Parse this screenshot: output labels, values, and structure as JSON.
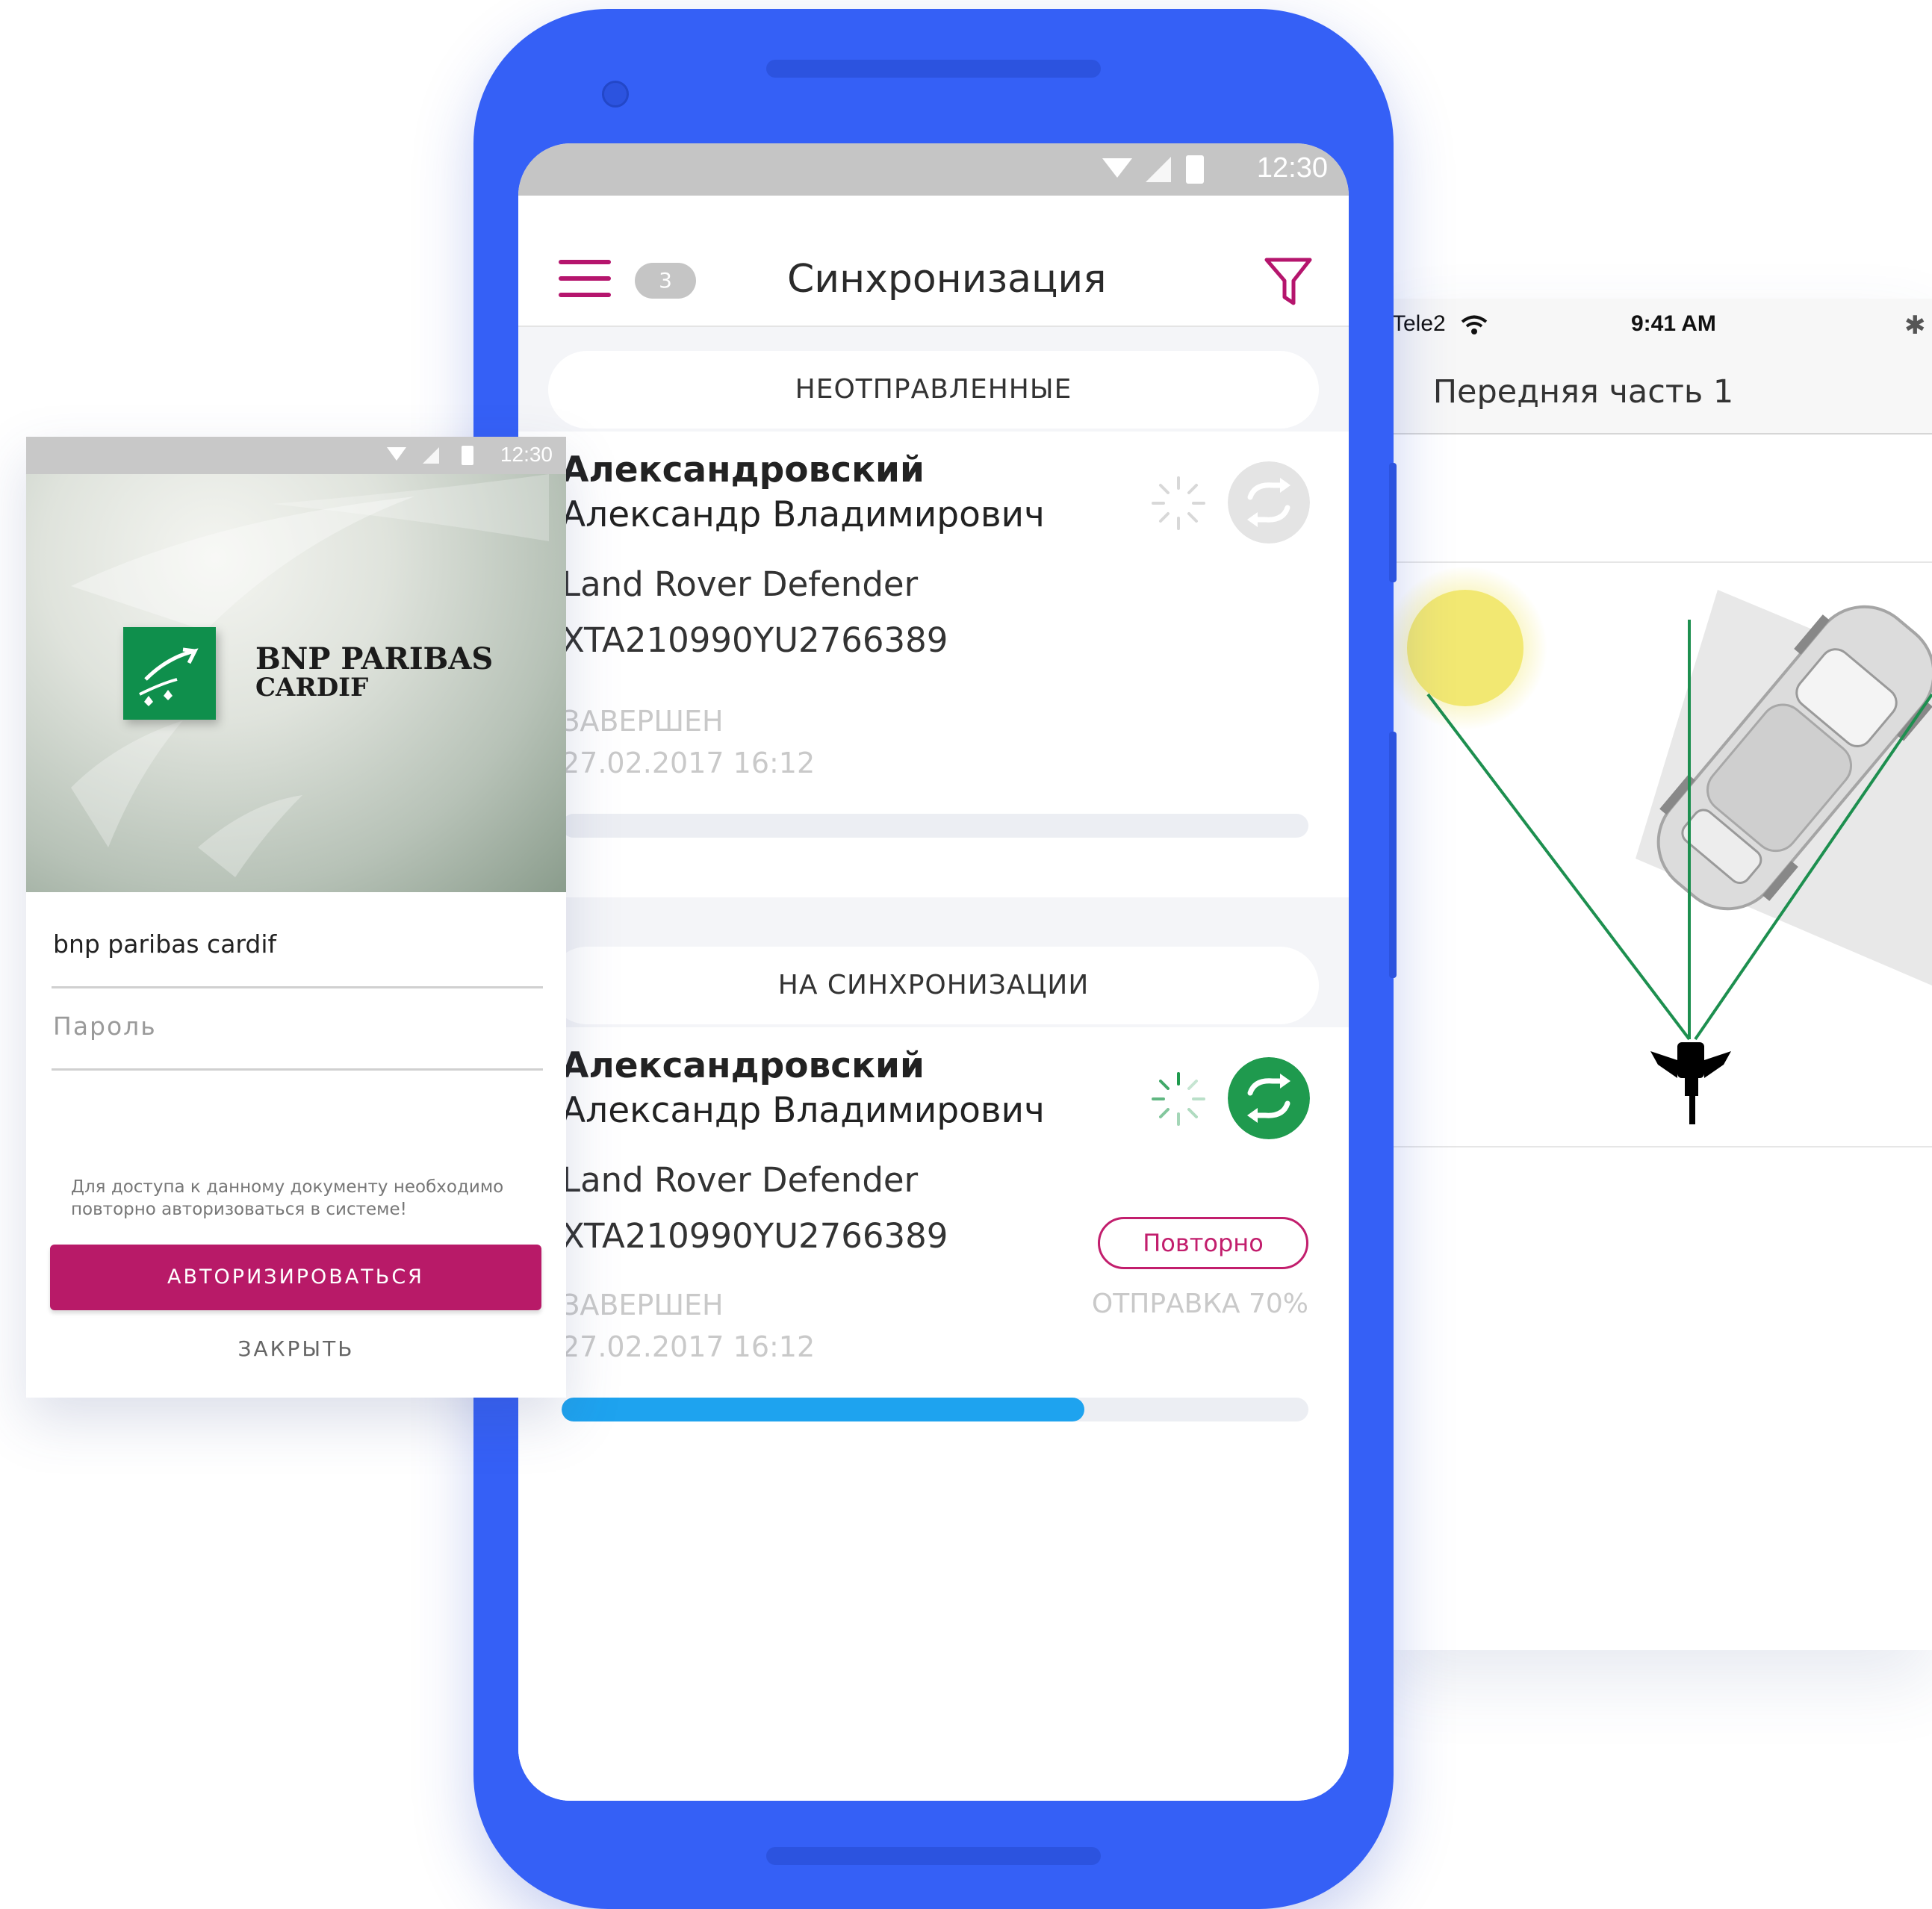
{
  "ios": {
    "carrier": "Tele2",
    "time": "9:41 AM",
    "title": "Передняя часть 1",
    "bluetooth_icon": "bluetooth-icon",
    "colors": {
      "sun": "#f2e872",
      "guide_lines": "#1d8f4f"
    }
  },
  "android": {
    "status_time": "12:30",
    "app_title": "Синхронизация",
    "badge_count": "3",
    "colors": {
      "accent": "#b5156d",
      "sync_green": "#1f9a4e",
      "progress": "#1ea3ef",
      "phone_body": "#3560f6"
    },
    "sections": [
      {
        "label": "НЕОТПРАВЛЕННЫЕ",
        "card": {
          "surname": "Александровский",
          "given_names": "Александр Владимирович",
          "car": "Land Rover Defender",
          "vin": "XTA210990YU2766389",
          "state": "ЗАВЕРШЕН",
          "date": "27.02.2017 16:12",
          "progress": 0
        }
      },
      {
        "label": "НА СИНХРОНИЗАЦИИ",
        "card": {
          "surname": "Александровский",
          "given_names": "Александр Владимирович",
          "car": "Land Rover Defender",
          "vin": "XTA210990YU2766389",
          "state": "ЗАВЕРШЕН",
          "date": "27.02.2017 16:12",
          "retry_label": "Повторно",
          "send_status": "ОТПРАВКА 70%",
          "progress": 0.7
        }
      }
    ]
  },
  "login": {
    "status_time": "12:30",
    "brand_name": "BNP PARIBAS",
    "brand_sub": "CARDIF",
    "username_value": "bnp paribas cardif",
    "password_placeholder": "Пароль",
    "hint": "Для доступа к данному документу необходимо повторно авторизоваться в системе!",
    "submit_label": "АВТОРИЗИРОВАТЬСЯ",
    "close_label": "ЗАКРЫТЬ",
    "colors": {
      "button": "#b81a68",
      "logo_green": "#0f8f4c"
    }
  }
}
